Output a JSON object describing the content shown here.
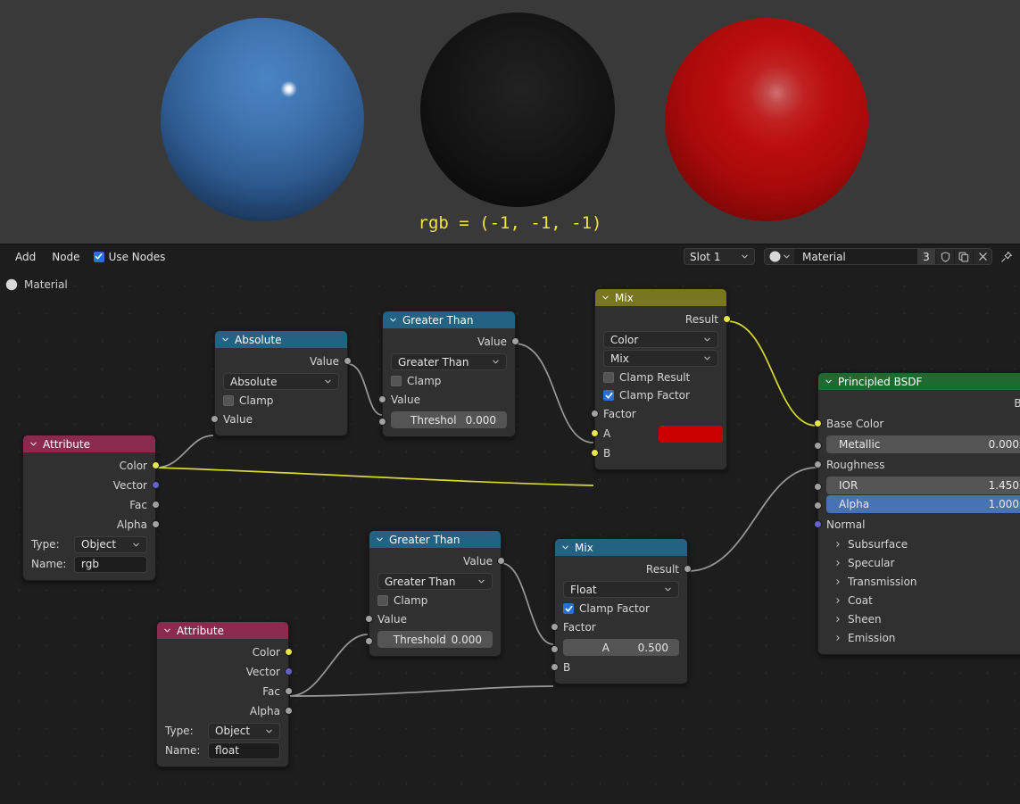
{
  "viewport": {
    "overlay_text": "rgb = (-1, -1, -1)",
    "background_color": "#393939",
    "spheres": [
      {
        "name": "sphere-blue",
        "color": "#2e5b90"
      },
      {
        "name": "sphere-black",
        "color": "#121212"
      },
      {
        "name": "sphere-red",
        "color": "#bb0d0d"
      }
    ]
  },
  "header": {
    "menus": [
      "Add",
      "Node"
    ],
    "use_nodes_label": "Use Nodes",
    "use_nodes_checked": true,
    "slot_label": "Slot 1",
    "material_name": "Material",
    "user_count": "3",
    "buttons": [
      "shield-icon",
      "copy-icon",
      "x-icon",
      "pin-icon"
    ]
  },
  "breadcrumb": {
    "label": "Material",
    "icon": "material-sphere-icon"
  },
  "nodes": {
    "attribute_rgb": {
      "title": "Attribute",
      "outputs": [
        "Color",
        "Vector",
        "Fac",
        "Alpha"
      ],
      "type_label": "Type:",
      "type_value": "Object",
      "name_label": "Name:",
      "name_value": "rgb"
    },
    "absolute": {
      "title": "Absolute",
      "output": "Value",
      "operation": "Absolute",
      "clamp_label": "Clamp",
      "clamp_checked": false,
      "input": "Value"
    },
    "greater_than_top": {
      "title": "Greater Than",
      "output": "Value",
      "operation": "Greater Than",
      "clamp_label": "Clamp",
      "clamp_checked": false,
      "input": "Value",
      "threshold_label": "Threshol",
      "threshold_value": "0.000"
    },
    "mix_color": {
      "title": "Mix",
      "output": "Result",
      "data_type": "Color",
      "blend_mode": "Mix",
      "clamp_result_label": "Clamp Result",
      "clamp_result_checked": false,
      "clamp_factor_label": "Clamp Factor",
      "clamp_factor_checked": true,
      "factor_label": "Factor",
      "a_label": "A",
      "a_color": "#c80000",
      "b_label": "B"
    },
    "greater_than_bottom": {
      "title": "Greater Than",
      "output": "Value",
      "operation": "Greater Than",
      "clamp_label": "Clamp",
      "clamp_checked": false,
      "input": "Value",
      "threshold_label": "Threshold",
      "threshold_value": "0.000"
    },
    "mix_float": {
      "title": "Mix",
      "output": "Result",
      "data_type": "Float",
      "clamp_factor_label": "Clamp Factor",
      "clamp_factor_checked": true,
      "factor_label": "Factor",
      "a_label": "A",
      "a_value": "0.500",
      "b_label": "B"
    },
    "attribute_float": {
      "title": "Attribute",
      "outputs": [
        "Color",
        "Vector",
        "Fac",
        "Alpha"
      ],
      "type_label": "Type:",
      "type_value": "Object",
      "name_label": "Name:",
      "name_value": "float"
    },
    "principled_bsdf": {
      "title": "Principled BSDF",
      "output": "BS",
      "base_color_label": "Base Color",
      "metallic_label": "Metallic",
      "metallic_value": "0.000",
      "roughness_label": "Roughness",
      "ior_label": "IOR",
      "ior_value": "1.450",
      "alpha_label": "Alpha",
      "alpha_value": "1.000",
      "normal_label": "Normal",
      "panels": [
        "Subsurface",
        "Specular",
        "Transmission",
        "Coat",
        "Sheen",
        "Emission"
      ]
    }
  },
  "colors": {
    "socket_yellow": "#e6e64a",
    "socket_gray": "#a1a1a1",
    "socket_purple": "#6363c7",
    "wire_yellow": "#d8d830",
    "wire_gray": "#9a9a9a",
    "header_converter": "#246283",
    "header_input": "#8a2b4d",
    "header_shader": "#1f6a2f",
    "header_mix_color": "#78761f",
    "accent_blue": "#2b6fd4"
  }
}
